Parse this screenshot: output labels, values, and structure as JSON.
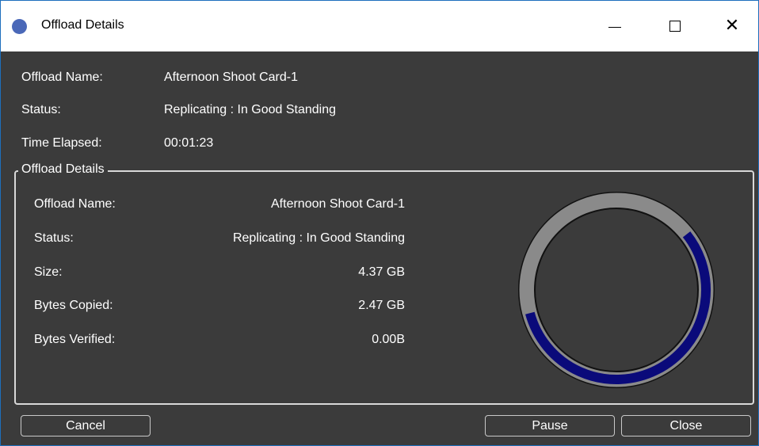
{
  "window": {
    "title": "Offload Details",
    "controls": {
      "minimize": "minimize",
      "maximize": "maximize",
      "close": "close"
    }
  },
  "summary": {
    "name_label": "Offload Name:",
    "name_value": "Afternoon Shoot Card-1",
    "status_label": "Status:",
    "status_value": "Replicating : In Good Standing",
    "elapsed_label": "Time Elapsed:",
    "elapsed_value": "00:01:23"
  },
  "details": {
    "legend": "Offload Details",
    "name_label": "Offload Name:",
    "name_value": "Afternoon Shoot Card-1",
    "status_label": "Status:",
    "status_value": "Replicating : In Good Standing",
    "size_label": "Size:",
    "size_value": "4.37 GB",
    "copied_label": "Bytes Copied:",
    "copied_value": "2.47 GB",
    "verified_label": "Bytes Verified:",
    "verified_value": "0.00B"
  },
  "progress": {
    "fraction": 0.565,
    "track_color": "#8a8a8a",
    "fill_color": "#0a0a7a"
  },
  "buttons": {
    "cancel": "Cancel",
    "pause": "Pause",
    "close": "Close"
  },
  "colors": {
    "background": "#3b3b3b",
    "title_bar": "#ffffff",
    "app_icon": "#4a68b8"
  }
}
